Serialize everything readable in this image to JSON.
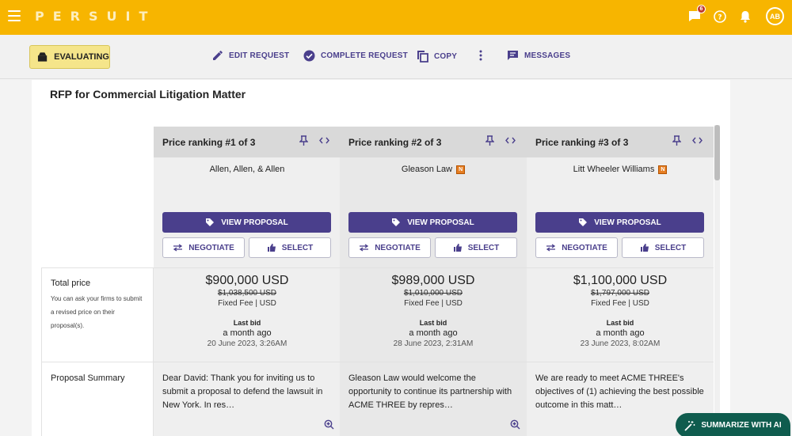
{
  "app": {
    "logo": "PERSUIT",
    "notification_count": "6",
    "avatar_initials": "AB"
  },
  "toolbar": {
    "status": "EVALUATING",
    "edit_request": "EDIT REQUEST",
    "complete_request": "COMPLETE REQUEST",
    "copy": "COPY",
    "messages": "MESSAGES"
  },
  "rfp": {
    "title": "RFP for Commercial Litigation Matter"
  },
  "row_labels": {
    "total_price": "Total price",
    "total_price_note": "You can ask your firms to submit a revised price on their proposal(s).",
    "proposal_summary": "Proposal Summary"
  },
  "buttons": {
    "view_proposal": "VIEW PROPOSAL",
    "negotiate": "NEGOTIATE",
    "select": "SELECT"
  },
  "proposals": [
    {
      "ranking": "Price ranking #1 of 3",
      "firm": "Allen, Allen, & Allen",
      "badge": "",
      "price": "$900,000 USD",
      "old_price": "$1,038,500 USD",
      "fee_type": "Fixed Fee | USD",
      "last_bid_label": "Last bid",
      "last_bid_ago": "a month ago",
      "last_bid_date": "20 June 2023, 3:26AM",
      "summary": "Dear David: Thank you for inviting us to submit a proposal to defend the lawsuit in New York. In res…"
    },
    {
      "ranking": "Price ranking #2 of 3",
      "firm": "Gleason Law",
      "badge": "N",
      "price": "$989,000 USD",
      "old_price": "$1,010,000 USD",
      "fee_type": "Fixed Fee | USD",
      "last_bid_label": "Last bid",
      "last_bid_ago": "a month ago",
      "last_bid_date": "28 June 2023, 2:31AM",
      "summary": "Gleason Law would welcome the opportunity to continue its partnership with ACME THREE by repres…"
    },
    {
      "ranking": "Price ranking #3 of 3",
      "firm": "Litt Wheeler Williams",
      "badge": "N",
      "price": "$1,100,000 USD",
      "old_price": "$1,797,000 USD",
      "fee_type": "Fixed Fee | USD",
      "last_bid_label": "Last bid",
      "last_bid_ago": "a month ago",
      "last_bid_date": "23 June 2023, 8:02AM",
      "summary": "We are ready to meet ACME THREE's objectives of (1) achieving the best possible outcome in this matt…"
    }
  ],
  "ai": {
    "summarize": "SUMMARIZE WITH AI"
  },
  "colors": {
    "brand_yellow": "#f7b500",
    "accent_purple": "#4a3f8c",
    "ai_green": "#0f5c4e",
    "status_chip": "#f5e58a"
  }
}
